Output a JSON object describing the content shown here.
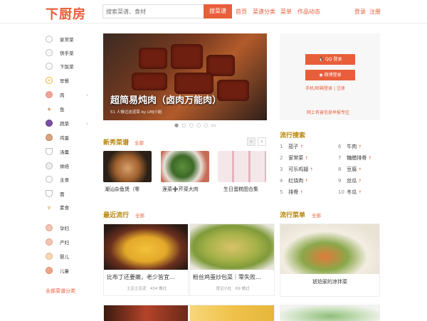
{
  "header": {
    "logo": "下厨房",
    "search_placeholder": "搜索菜谱、食材",
    "search_button": "搜菜谱",
    "nav": [
      "首页",
      "菜谱分类",
      "菜单",
      "作品动态"
    ],
    "login": "登录",
    "register": "注册"
  },
  "sidebar": {
    "items": [
      {
        "label": "家常菜",
        "icon": "plate-icon"
      },
      {
        "label": "快手菜",
        "icon": "clock-icon"
      },
      {
        "label": "下饭菜",
        "icon": "bowl-icon"
      },
      {
        "label": "早餐",
        "icon": "sun-icon"
      },
      {
        "label": "肉",
        "icon": "pig-icon"
      },
      {
        "label": "鱼",
        "icon": "fish-icon"
      },
      {
        "label": "蔬菜",
        "icon": "vegetable-icon"
      },
      {
        "label": "鸡蛋",
        "icon": "egg-icon"
      },
      {
        "label": "汤羹",
        "icon": "soup-icon"
      },
      {
        "label": "烘焙",
        "icon": "cake-icon"
      },
      {
        "label": "主食",
        "icon": "rice-icon"
      },
      {
        "label": "面",
        "icon": "noodle-icon"
      },
      {
        "label": "素食",
        "icon": "wheat-icon"
      },
      {
        "label": "孕妇",
        "icon": "pregnant-icon"
      },
      {
        "label": "产妇",
        "icon": "mother-icon"
      },
      {
        "label": "婴儿",
        "icon": "baby-icon"
      },
      {
        "label": "儿童",
        "icon": "child-icon"
      }
    ],
    "all_label": "全部菜谱分类"
  },
  "hero": {
    "title": "超简易炖肉（卤肉万能肉）",
    "meta": "51 人做过这道菜    by LMJ小姐"
  },
  "new_recipes": {
    "title": "新秀菜谱",
    "all": "全部",
    "items": [
      "潮汕杂鱼煲（零",
      "莲菜➕芹菜大肉",
      "生日蛋糕图合集"
    ]
  },
  "trending": {
    "title": "最近流行",
    "all": "全部",
    "cards": [
      {
        "title": "比布丁还要嫩，老少皆宜...",
        "author": "土豆土豆泥",
        "count": "434 做过"
      },
      {
        "title": "粉丝鸡蛋炒包菜｜零失败...",
        "author": "张记小灶",
        "count": "69 做过"
      }
    ]
  },
  "login_panel": {
    "qq_button": "QQ 登录",
    "weibo_button": "微博登录",
    "phone_login": "手机/邮箱登录",
    "register": "注册",
    "help": "网上有害信息举报专区"
  },
  "hot_search": {
    "title": "流行搜索",
    "items": [
      {
        "n": "1",
        "label": "茄子"
      },
      {
        "n": "2",
        "label": "家常菜"
      },
      {
        "n": "3",
        "label": "可乐鸡翅"
      },
      {
        "n": "4",
        "label": "红烧肉"
      },
      {
        "n": "5",
        "label": "排骨"
      },
      {
        "n": "6",
        "label": "牛肉"
      },
      {
        "n": "7",
        "label": "糖醋排骨"
      },
      {
        "n": "8",
        "label": "豆腐"
      },
      {
        "n": "9",
        "label": "丝瓜"
      },
      {
        "n": "10",
        "label": "冬瓜"
      }
    ]
  },
  "popular_menu": {
    "title": "流行菜单",
    "all": "全部",
    "card_title": "琥珀家的凉拌菜"
  }
}
